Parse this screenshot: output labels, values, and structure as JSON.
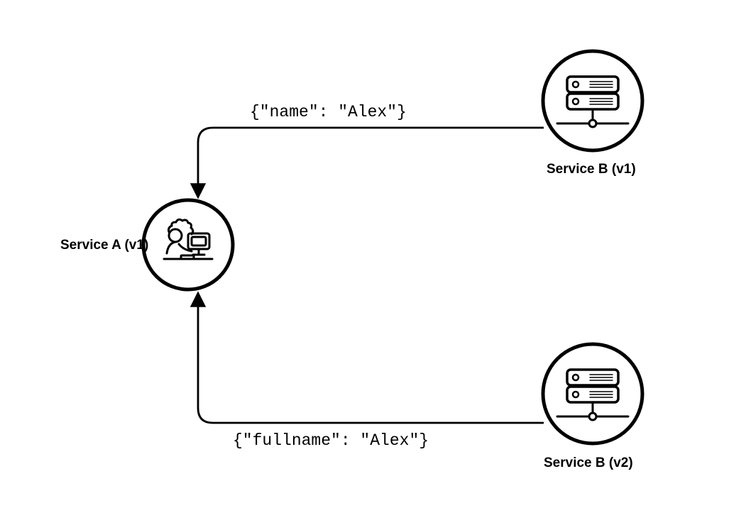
{
  "nodes": {
    "service_a": {
      "label": "Service A (v1)"
    },
    "service_b_v1": {
      "label": "Service B (v1)"
    },
    "service_b_v2": {
      "label": "Service B (v2)"
    }
  },
  "edges": {
    "b1_to_a": {
      "payload": "{\"name\": \"Alex\"}"
    },
    "b2_to_a": {
      "payload": "{\"fullname\": \"Alex\"}"
    }
  }
}
